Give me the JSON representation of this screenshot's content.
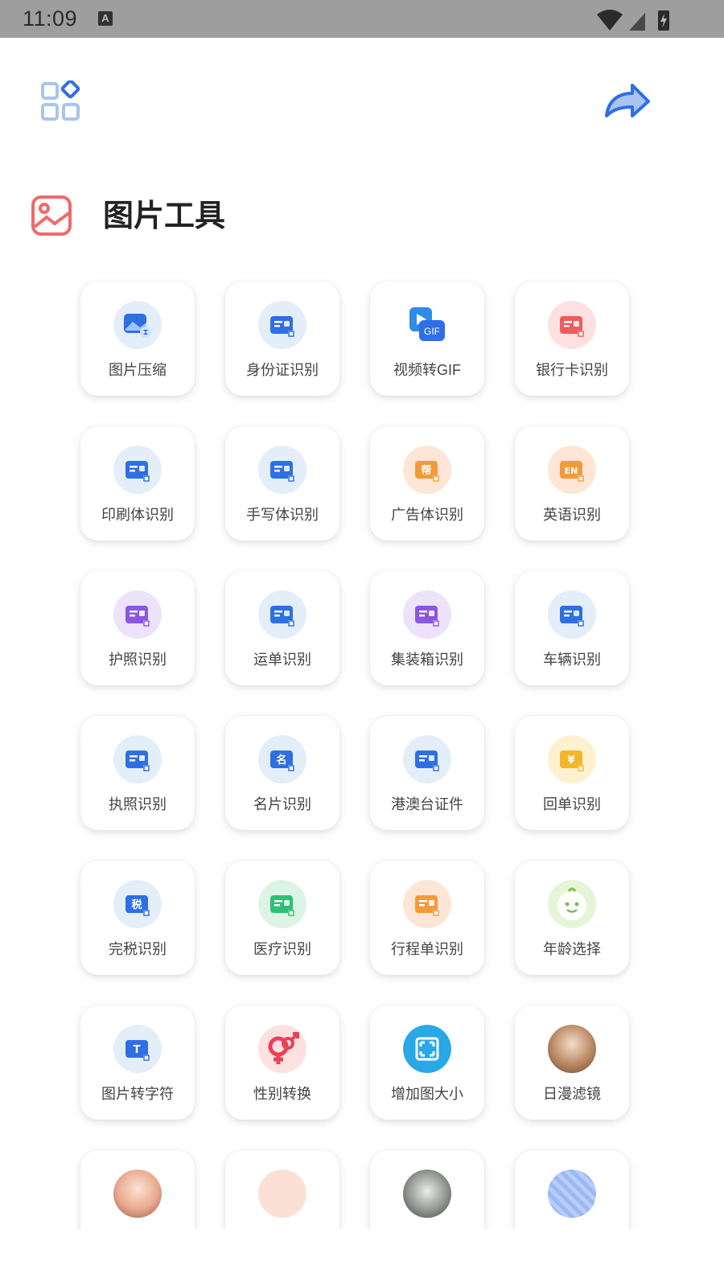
{
  "status_bar": {
    "time": "11:09",
    "badge": "A"
  },
  "header": {
    "menu_icon": "grid-menu-icon",
    "share_icon": "share-arrow-icon"
  },
  "section": {
    "title": "图片工具",
    "icon": "image-icon"
  },
  "colors": {
    "accent_blue": "#2f6fe4",
    "section_red": "#ee6a6a",
    "card_shadow": "#00000022"
  },
  "tools": [
    {
      "label": "图片压缩",
      "icon": "image-compress-icon",
      "bg": "b-blue"
    },
    {
      "label": "身份证识别",
      "icon": "id-card-scan-icon",
      "bg": "b-blue"
    },
    {
      "label": "视频转GIF",
      "icon": "video-gif-icon",
      "bg": "b-none",
      "icon_text": "GIF"
    },
    {
      "label": "银行卡识别",
      "icon": "bank-card-scan-icon",
      "bg": "b-red"
    },
    {
      "label": "印刷体识别",
      "icon": "print-text-scan-icon",
      "bg": "b-blue"
    },
    {
      "label": "手写体识别",
      "icon": "handwriting-scan-icon",
      "bg": "b-blue"
    },
    {
      "label": "广告体识别",
      "icon": "ad-text-scan-icon",
      "bg": "b-orange",
      "icon_text": "帮"
    },
    {
      "label": "英语识别",
      "icon": "english-scan-icon",
      "bg": "b-orange",
      "icon_text": "EN"
    },
    {
      "label": "护照识别",
      "icon": "passport-scan-icon",
      "bg": "b-purple"
    },
    {
      "label": "运单识别",
      "icon": "waybill-scan-icon",
      "bg": "b-blue"
    },
    {
      "label": "集装箱识别",
      "icon": "container-scan-icon",
      "bg": "b-purple"
    },
    {
      "label": "车辆识别",
      "icon": "vehicle-scan-icon",
      "bg": "b-blue"
    },
    {
      "label": "执照识别",
      "icon": "license-scan-icon",
      "bg": "b-blue"
    },
    {
      "label": "名片识别",
      "icon": "business-card-scan-icon",
      "bg": "b-blue",
      "icon_text": "名"
    },
    {
      "label": "港澳台证件",
      "icon": "hk-macau-tw-pass-icon",
      "bg": "b-blue"
    },
    {
      "label": "回单识别",
      "icon": "receipt-scan-icon",
      "bg": "b-yellow",
      "icon_text": "¥"
    },
    {
      "label": "完税识别",
      "icon": "tax-scan-icon",
      "bg": "b-blue",
      "icon_text": "税"
    },
    {
      "label": "医疗识别",
      "icon": "medical-scan-icon",
      "bg": "b-green"
    },
    {
      "label": "行程单识别",
      "icon": "itinerary-scan-icon",
      "bg": "b-orange"
    },
    {
      "label": "年龄选择",
      "icon": "baby-face-icon",
      "bg": "b-lime"
    },
    {
      "label": "图片转字符",
      "icon": "image-to-text-icon",
      "bg": "b-blue",
      "icon_text": "T"
    },
    {
      "label": "性别转换",
      "icon": "gender-swap-icon",
      "bg": "b-red"
    },
    {
      "label": "增加图大小",
      "icon": "enlarge-image-icon",
      "bg": "b-none"
    },
    {
      "label": "日漫滤镜",
      "icon": "anime-filter-thumb-icon",
      "bg": "b-photo1"
    },
    {
      "label": "",
      "icon": "anime-girl-thumb-icon",
      "bg": "b-photo2"
    },
    {
      "label": "",
      "icon": "cartoon-girl-thumb-icon",
      "bg": "b-photo4"
    },
    {
      "label": "",
      "icon": "portrait-photo-thumb-icon",
      "bg": "b-photo3"
    },
    {
      "label": "",
      "icon": "blonde-avatar-thumb-icon",
      "bg": "b-photo5"
    }
  ]
}
